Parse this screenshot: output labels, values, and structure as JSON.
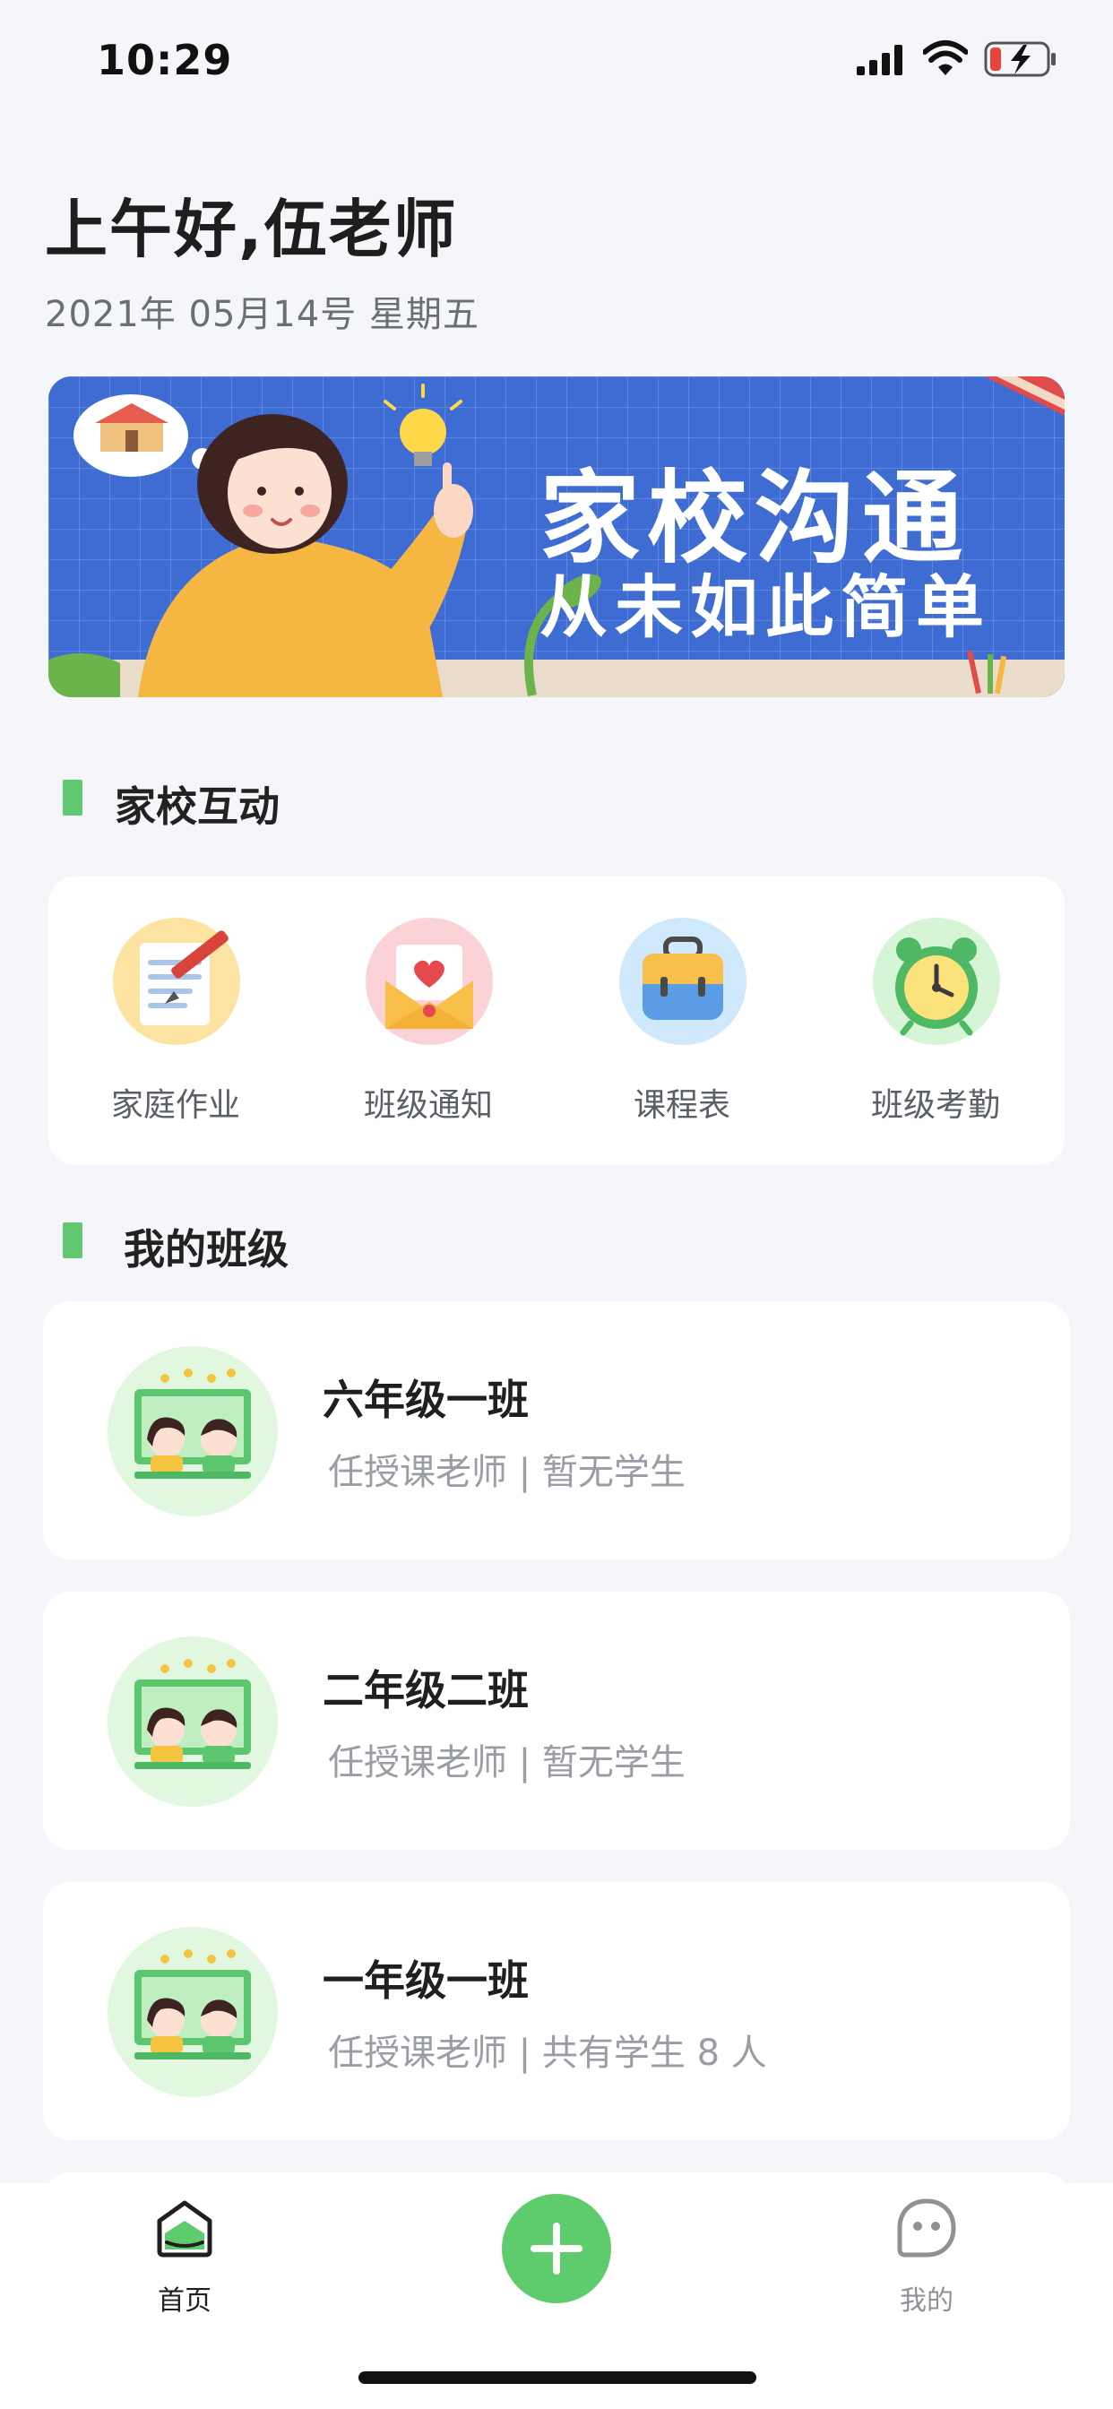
{
  "status_bar": {
    "time": "10:29"
  },
  "header": {
    "greeting": "上午好,伍老师",
    "date": "2021年 05月14号  星期五"
  },
  "banner": {
    "title": "家校沟通",
    "subtitle": "从未如此简单"
  },
  "interaction_section": {
    "title": "家校互动",
    "items": [
      {
        "label": "家庭作业",
        "icon": "homework-icon"
      },
      {
        "label": "班级通知",
        "icon": "notice-envelope-icon"
      },
      {
        "label": "课程表",
        "icon": "schedule-bag-icon"
      },
      {
        "label": "班级考勤",
        "icon": "attendance-clock-icon"
      }
    ]
  },
  "class_section": {
    "title": "我的班级",
    "classes": [
      {
        "name": "六年级一班",
        "info": "任授课老师 | 暂无学生"
      },
      {
        "name": "二年级二班",
        "info": "任授课老师 | 暂无学生"
      },
      {
        "name": "一年级一班",
        "info": "任授课老师 | 共有学生 8 人"
      }
    ]
  },
  "tab_bar": {
    "home_label": "首页",
    "mine_label": "我的",
    "active_color": "#1f1f1f",
    "inactive_color": "#8e9196",
    "accent_color": "#5ecb6d"
  }
}
